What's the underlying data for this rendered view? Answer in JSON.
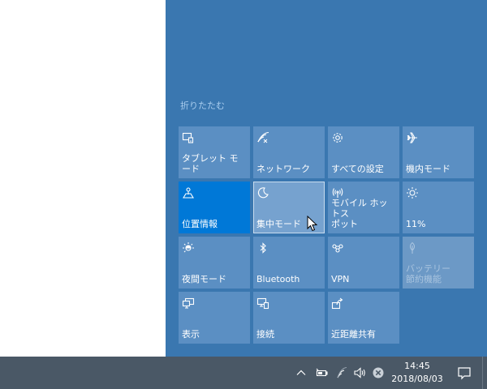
{
  "action_center": {
    "collapse_label": "折りたたむ",
    "tiles": [
      {
        "label": "タブレット モード",
        "icon": "tablet-mode-icon",
        "state": "normal"
      },
      {
        "label": "ネットワーク",
        "icon": "network-icon",
        "state": "normal"
      },
      {
        "label": "すべての設定",
        "icon": "settings-gear-icon",
        "state": "normal"
      },
      {
        "label": "機内モード",
        "icon": "airplane-icon",
        "state": "normal"
      },
      {
        "label": "位置情報",
        "icon": "location-icon",
        "state": "active"
      },
      {
        "label": "集中モード",
        "icon": "moon-icon",
        "state": "hover"
      },
      {
        "label": "モバイル ホットス\nポット",
        "icon": "mobile-hotspot-icon",
        "state": "normal"
      },
      {
        "label": "11%",
        "icon": "brightness-icon",
        "state": "normal"
      },
      {
        "label": "夜間モード",
        "icon": "night-light-icon",
        "state": "normal"
      },
      {
        "label": "Bluetooth",
        "icon": "bluetooth-icon",
        "state": "normal"
      },
      {
        "label": "VPN",
        "icon": "vpn-icon",
        "state": "normal"
      },
      {
        "label": "バッテリー\n節約機能",
        "icon": "battery-saver-icon",
        "state": "disabled"
      },
      {
        "label": "表示",
        "icon": "project-display-icon",
        "state": "normal"
      },
      {
        "label": "接続",
        "icon": "connect-icon",
        "state": "normal"
      },
      {
        "label": "近距離共有",
        "icon": "nearby-share-icon",
        "state": "normal"
      }
    ]
  },
  "taskbar": {
    "time": "14:45",
    "date": "2018/08/03",
    "tray_icons": [
      "chevron-up-icon",
      "battery-icon",
      "wifi-icon",
      "volume-icon",
      "x-circle-icon"
    ]
  },
  "colors": {
    "panel": "#3a77b0",
    "tile": "#5b8fc3",
    "tile_active": "#0078d7",
    "taskbar": "#4a5866"
  }
}
